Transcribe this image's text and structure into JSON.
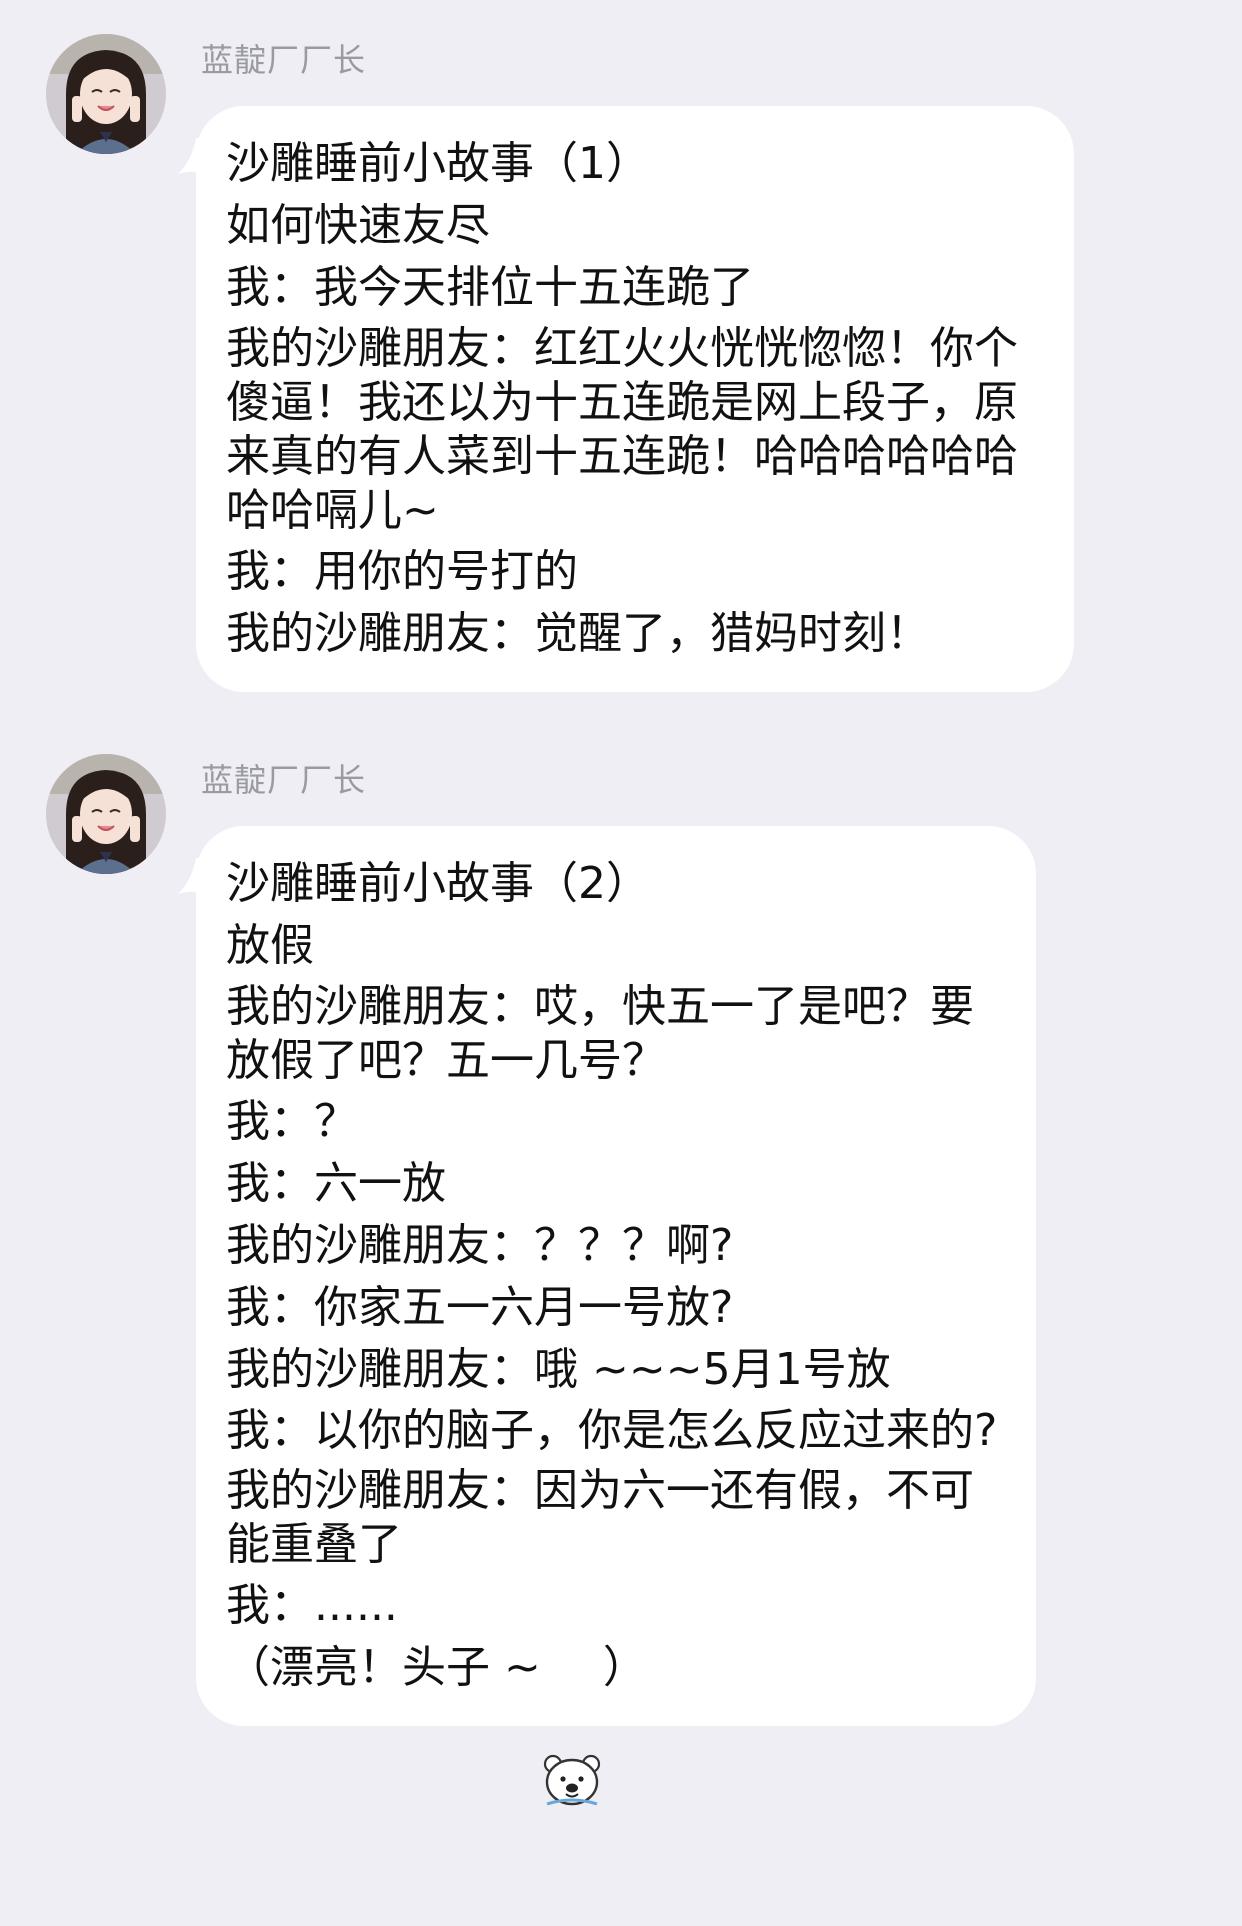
{
  "messages": [
    {
      "sender": "蓝靛厂厂长",
      "lines": [
        "沙雕睡前小故事（1）",
        "如何快速友尽",
        "我：我今天排位十五连跪了",
        "我的沙雕朋友：红红火火恍恍惚惚！你个傻逼！我还以为十五连跪是网上段子，原来真的有人菜到十五连跪！哈哈哈哈哈哈哈哈嗝儿~",
        "我：用你的号打的",
        "我的沙雕朋友：觉醒了，猎妈时刻！"
      ]
    },
    {
      "sender": "蓝靛厂厂长",
      "lines": [
        "沙雕睡前小故事（2）",
        "放假",
        "我的沙雕朋友：哎，快五一了是吧？要放假了吧？五一几号？",
        "我：？",
        "我：六一放",
        "我的沙雕朋友：？？？啊?",
        "我：你家五一六月一号放?",
        "我的沙雕朋友：哦 ~~~5月1号放",
        "我：以你的脑子，你是怎么反应过来的?",
        "我的沙雕朋友：因为六一还有假，不可能重叠了",
        "我：......"
      ],
      "closing_prefix": "（漂亮！头子 ~",
      "closing_suffix": "）",
      "closing_emoji": "polar-bear-emoji"
    }
  ],
  "colors": {
    "background": "#efeef5",
    "bubble": "#ffffff",
    "sender_text": "#9a9aa3",
    "message_text": "#111111"
  }
}
